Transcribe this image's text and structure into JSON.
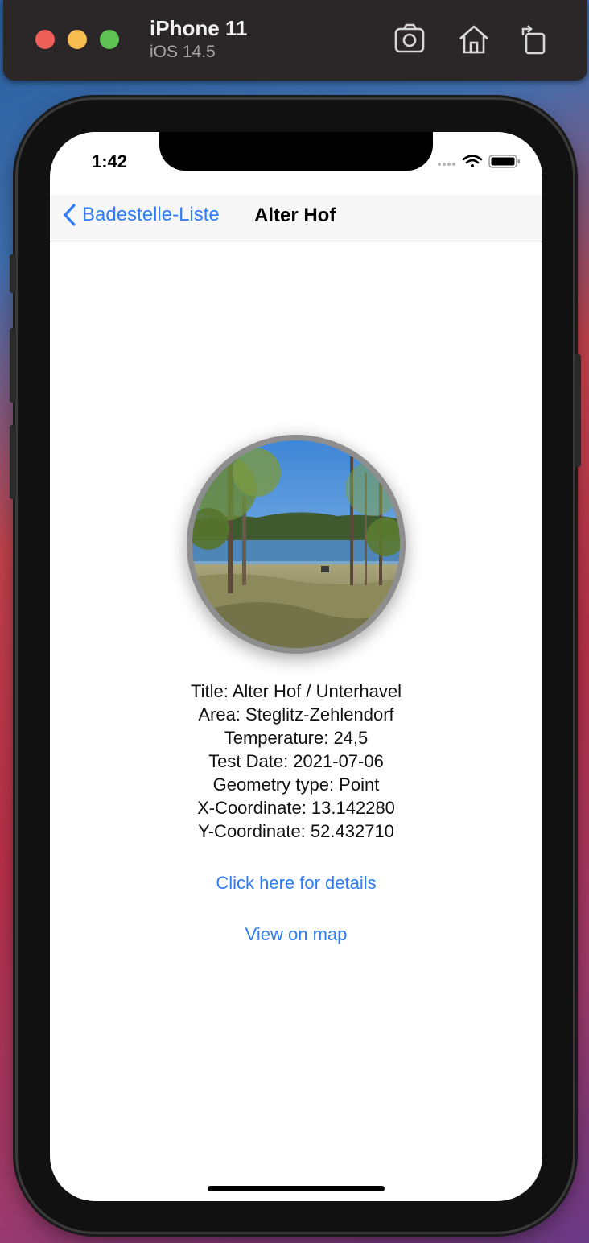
{
  "simulator": {
    "device_name": "iPhone 11",
    "os_version": "iOS 14.5",
    "icons": [
      "screenshot-icon",
      "home-icon",
      "rotate-icon"
    ]
  },
  "status_bar": {
    "time": "1:42",
    "icons": [
      "cellular-icon",
      "wifi-icon",
      "battery-icon"
    ]
  },
  "nav": {
    "back_label": "Badestelle-Liste",
    "title": "Alter Hof"
  },
  "details": {
    "title": "Title: Alter Hof / Unterhavel",
    "area": "Area: Steglitz-Zehlendorf",
    "temperature": "Temperature: 24,5",
    "test_date": "Test Date: 2021-07-06",
    "geometry_type": "Geometry type: Point",
    "x_coordinate": "X-Coordinate: 13.142280",
    "y_coordinate": "Y-Coordinate: 52.432710"
  },
  "links": {
    "details": "Click here for details",
    "map": "View on map"
  },
  "colors": {
    "accent": "#2f7cf6",
    "titlebar": "#2b2728"
  }
}
